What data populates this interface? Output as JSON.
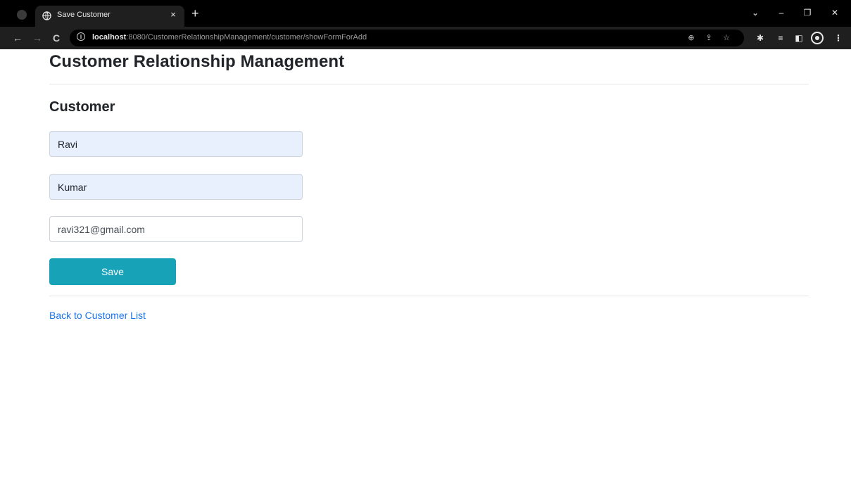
{
  "browser": {
    "tab": {
      "title": "Save Customer",
      "close": "×"
    },
    "new_tab": "+",
    "window_controls": {
      "list_tabs": "⌄",
      "minimize": "–",
      "restore": "❐",
      "close": "✕"
    },
    "nav": {
      "back": "←",
      "forward": "→",
      "reload": "C"
    },
    "address": {
      "host": "localhost",
      "rest": ":8080/CustomerRelationshipManagement/customer/showFormForAdd"
    },
    "omnibox_icons": {
      "zoom": "⊕",
      "share": "⇪",
      "bookmark": "☆"
    },
    "toolbar_icons": {
      "extensions": "✱",
      "reading_list": "≡",
      "side_panel": "◧",
      "menu": "⋮"
    }
  },
  "page": {
    "title": "Customer Relationship Management",
    "section": "Customer",
    "form": {
      "first_name": "Ravi",
      "last_name": "Kumar",
      "email": "ravi321@gmail.com"
    },
    "save_label": "Save",
    "back_link": "Back to Customer List"
  },
  "colors": {
    "button": "#17a2b8",
    "link": "#1a73e8",
    "autofill_bg": "#e8f0fe"
  }
}
